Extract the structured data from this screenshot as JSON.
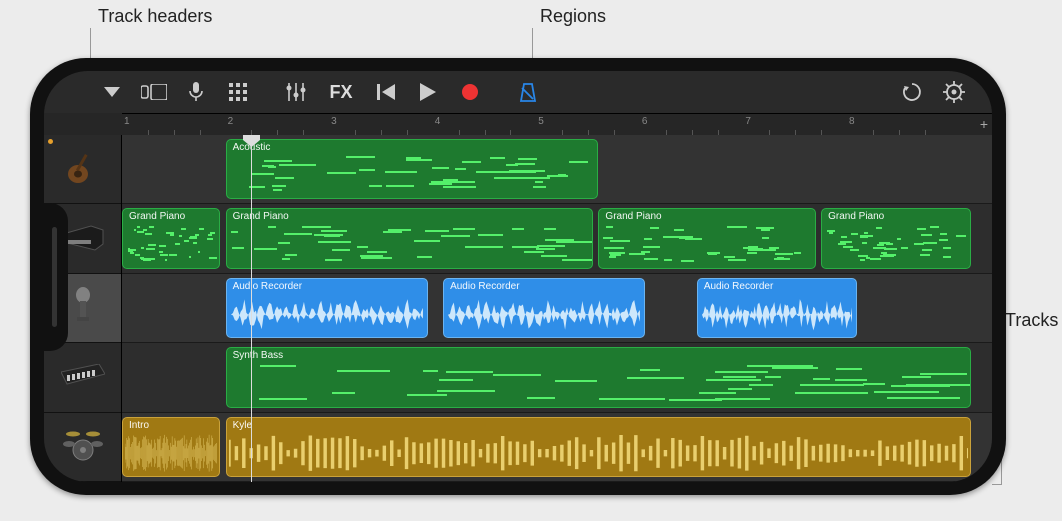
{
  "annotations": {
    "track_headers": "Track headers",
    "regions": "Regions",
    "tracks": "Tracks"
  },
  "toolbar": {
    "view_menu": "view-menu",
    "track_view": "track-view",
    "mic": "microphone",
    "grid": "sampler-grid",
    "mixer": "mixer",
    "fx": "FX",
    "rewind": "rewind",
    "play": "play",
    "record": "record",
    "metronome": "metronome",
    "loop": "loop",
    "settings": "settings"
  },
  "ruler": {
    "bars": [
      "1",
      "2",
      "3",
      "4",
      "5",
      "6",
      "7",
      "8"
    ],
    "add": "+"
  },
  "playhead_bar": 1.25,
  "tracks": [
    {
      "id": "guitar",
      "icon": "guitar-icon",
      "selected": false,
      "muted": true,
      "regions": [
        {
          "name": "Acoustic",
          "type": "midi",
          "start": 1,
          "end": 4.6
        }
      ]
    },
    {
      "id": "piano",
      "icon": "piano-icon",
      "selected": false,
      "regions": [
        {
          "name": "Grand Piano",
          "type": "midi",
          "start": 0,
          "end": 0.95
        },
        {
          "name": "Grand Piano",
          "type": "midi",
          "start": 1,
          "end": 4.55
        },
        {
          "name": "Grand Piano",
          "type": "midi",
          "start": 4.6,
          "end": 6.7
        },
        {
          "name": "Grand Piano",
          "type": "midi",
          "start": 6.75,
          "end": 8.2
        }
      ]
    },
    {
      "id": "audio",
      "icon": "mic-icon",
      "selected": true,
      "regions": [
        {
          "name": "Audio Recorder",
          "type": "audio",
          "start": 1,
          "end": 2.95
        },
        {
          "name": "Audio Recorder",
          "type": "audio",
          "start": 3.1,
          "end": 5.05
        },
        {
          "name": "Audio Recorder",
          "type": "audio",
          "start": 5.55,
          "end": 7.1
        }
      ]
    },
    {
      "id": "synth",
      "icon": "keyboard-icon",
      "selected": false,
      "regions": [
        {
          "name": "Synth Bass",
          "type": "midi",
          "start": 1,
          "end": 8.2
        }
      ]
    },
    {
      "id": "drums",
      "icon": "drums-icon",
      "selected": false,
      "regions": [
        {
          "name": "Intro",
          "type": "drum",
          "start": 0,
          "end": 0.95
        },
        {
          "name": "Kyle",
          "type": "drum",
          "start": 1,
          "end": 8.2
        }
      ]
    }
  ]
}
